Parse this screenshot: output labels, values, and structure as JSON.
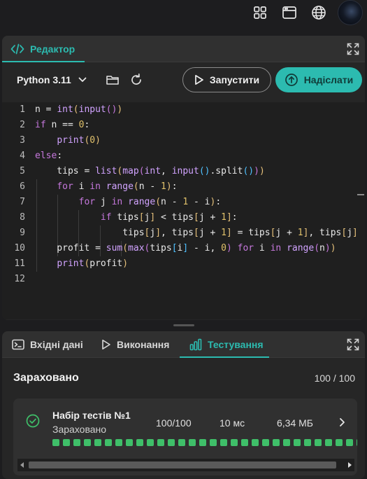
{
  "topbar": {
    "icons": [
      "grid-icon",
      "browser-window-icon",
      "globe-icon"
    ],
    "avatar": "user-avatar"
  },
  "editor": {
    "tab_label": "Редактор",
    "language": "Python 3.11",
    "run_label": "Запустити",
    "submit_label": "Надіслати",
    "line_numbers": [
      "1",
      "2",
      "3",
      "4",
      "5",
      "6",
      "7",
      "8",
      "9",
      "10",
      "11",
      "12"
    ]
  },
  "bottom": {
    "tabs": [
      {
        "label": "Вхідні дані",
        "icon": "terminal-icon"
      },
      {
        "label": "Виконання",
        "icon": "play-icon"
      },
      {
        "label": "Тестування",
        "icon": "bar-chart-icon"
      }
    ],
    "result_title": "Зараховано",
    "result_score": "100 / 100",
    "card": {
      "name": "Набір тестів №1",
      "status": "Зараховано",
      "score": "100/100",
      "time": "10 мс",
      "memory": "6,34 МБ",
      "passed_tests": 30
    }
  },
  "colors": {
    "accent": "#2cbbb0",
    "success": "#3fbf69",
    "background": "#1d1d1f"
  }
}
